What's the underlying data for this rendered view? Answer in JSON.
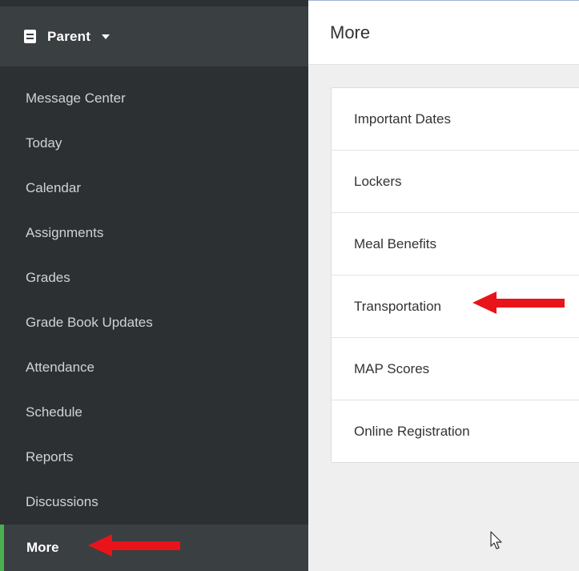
{
  "sidebar": {
    "role": {
      "label": "Parent",
      "icon": "document-icon",
      "dropdown_icon": "caret-down-icon"
    },
    "items": [
      {
        "label": "Message Center"
      },
      {
        "label": "Today"
      },
      {
        "label": "Calendar"
      },
      {
        "label": "Assignments"
      },
      {
        "label": "Grades"
      },
      {
        "label": "Grade Book Updates"
      },
      {
        "label": "Attendance"
      },
      {
        "label": "Schedule"
      },
      {
        "label": "Reports"
      },
      {
        "label": "Discussions"
      },
      {
        "label": "More",
        "active": true
      }
    ]
  },
  "main": {
    "title": "More",
    "items": [
      {
        "label": "Important Dates"
      },
      {
        "label": "Lockers"
      },
      {
        "label": "Meal Benefits"
      },
      {
        "label": "Transportation"
      },
      {
        "label": "MAP Scores"
      },
      {
        "label": "Online Registration"
      }
    ]
  },
  "colors": {
    "sidebar_bg": "#2c3033",
    "sidebar_header_bg": "#3a3f42",
    "active_indicator": "#4caf50",
    "annotation_arrow": "#e8141a",
    "main_bg": "#efefef"
  }
}
